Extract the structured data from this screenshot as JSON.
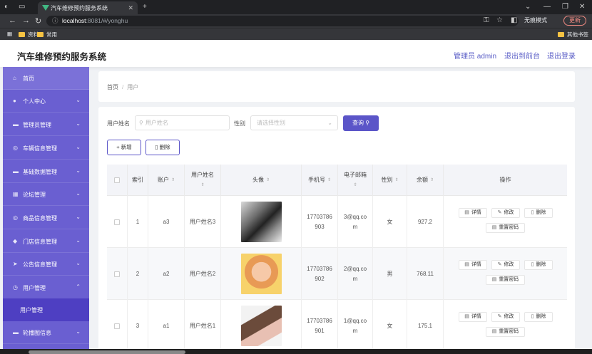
{
  "browser": {
    "tab_title": "汽车维修预约服务系统",
    "url_host": "localhost",
    "url_path": ":8081/#/yonghu",
    "incognito_label": "无痕模式",
    "update_label": "更新",
    "bookmarks": [
      "资料",
      "常用"
    ],
    "other_bookmarks": "其他书签"
  },
  "header": {
    "app_title": "汽车维修预约服务系统",
    "admin_label": "管理员 admin",
    "front_link": "退出到前台",
    "logout_link": "退出登录"
  },
  "sidebar": {
    "items": [
      {
        "label": "首页",
        "icon": "home-icon"
      },
      {
        "label": "个人中心",
        "icon": "user-icon"
      },
      {
        "label": "管理员管理",
        "icon": "monitor-icon"
      },
      {
        "label": "车辆信息管理",
        "icon": "compass-icon"
      },
      {
        "label": "基础数据管理",
        "icon": "monitor-icon"
      },
      {
        "label": "论坛管理",
        "icon": "grid-icon"
      },
      {
        "label": "商品信息管理",
        "icon": "compass-icon"
      },
      {
        "label": "门店信息管理",
        "icon": "shield-icon"
      },
      {
        "label": "公告信息管理",
        "icon": "send-icon"
      },
      {
        "label": "用户管理",
        "icon": "clock-icon"
      }
    ],
    "sub_item": "用户管理",
    "last_item": "轮播图信息"
  },
  "breadcrumb": {
    "home": "首页",
    "sep": "/",
    "current": "用户"
  },
  "filters": {
    "name_label": "用户姓名",
    "name_placeholder": "用户姓名",
    "gender_label": "性别",
    "gender_placeholder": "请选择性别",
    "search_button": "查询"
  },
  "actions": {
    "add": "新增",
    "delete": "删除"
  },
  "table": {
    "headers": {
      "index": "索引",
      "account": "账户",
      "name": "用户姓名",
      "avatar": "头像",
      "phone": "手机号",
      "email": "电子邮箱",
      "gender": "性别",
      "balance": "余额",
      "ops": "操作"
    },
    "rows": [
      {
        "index": "1",
        "account": "a3",
        "name": "用户姓名3",
        "phone1": "17703786",
        "phone2": "903",
        "email1": "3@qq.co",
        "email2": "m",
        "gender": "女",
        "balance": "927.2"
      },
      {
        "index": "2",
        "account": "a2",
        "name": "用户姓名2",
        "phone1": "17703786",
        "phone2": "902",
        "email1": "2@qq.co",
        "email2": "m",
        "gender": "男",
        "balance": "768.11"
      },
      {
        "index": "3",
        "account": "a1",
        "name": "用户姓名1",
        "phone1": "17703786",
        "phone2": "901",
        "email1": "1@qq.co",
        "email2": "m",
        "gender": "女",
        "balance": "175.1"
      }
    ],
    "op_labels": {
      "detail": "详情",
      "edit": "修改",
      "remove": "删除",
      "reset": "重置密码"
    }
  }
}
